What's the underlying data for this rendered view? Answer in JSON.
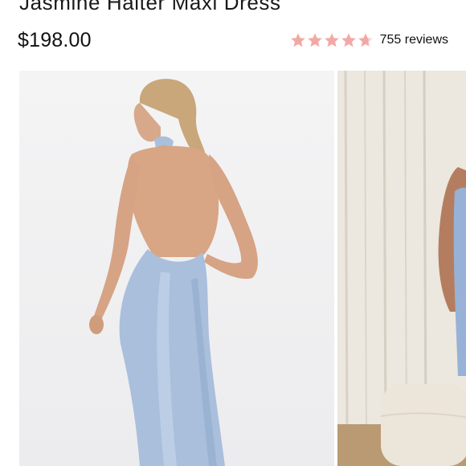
{
  "product": {
    "title": "Jasmine Halter Maxi Dress",
    "price": "$198.00"
  },
  "rating": {
    "value": 4.7,
    "max": 5,
    "reviews_label": "755 reviews",
    "star_icon": "star-icon",
    "star_color": "#f2a9a5"
  },
  "gallery": {
    "images": [
      {
        "name": "main-product-photo",
        "alt": "Model wearing the dress, back view"
      },
      {
        "name": "secondary-product-photo",
        "alt": "Model wearing the dress in a curtained room"
      }
    ],
    "dress_color": "#a9bfdc"
  }
}
